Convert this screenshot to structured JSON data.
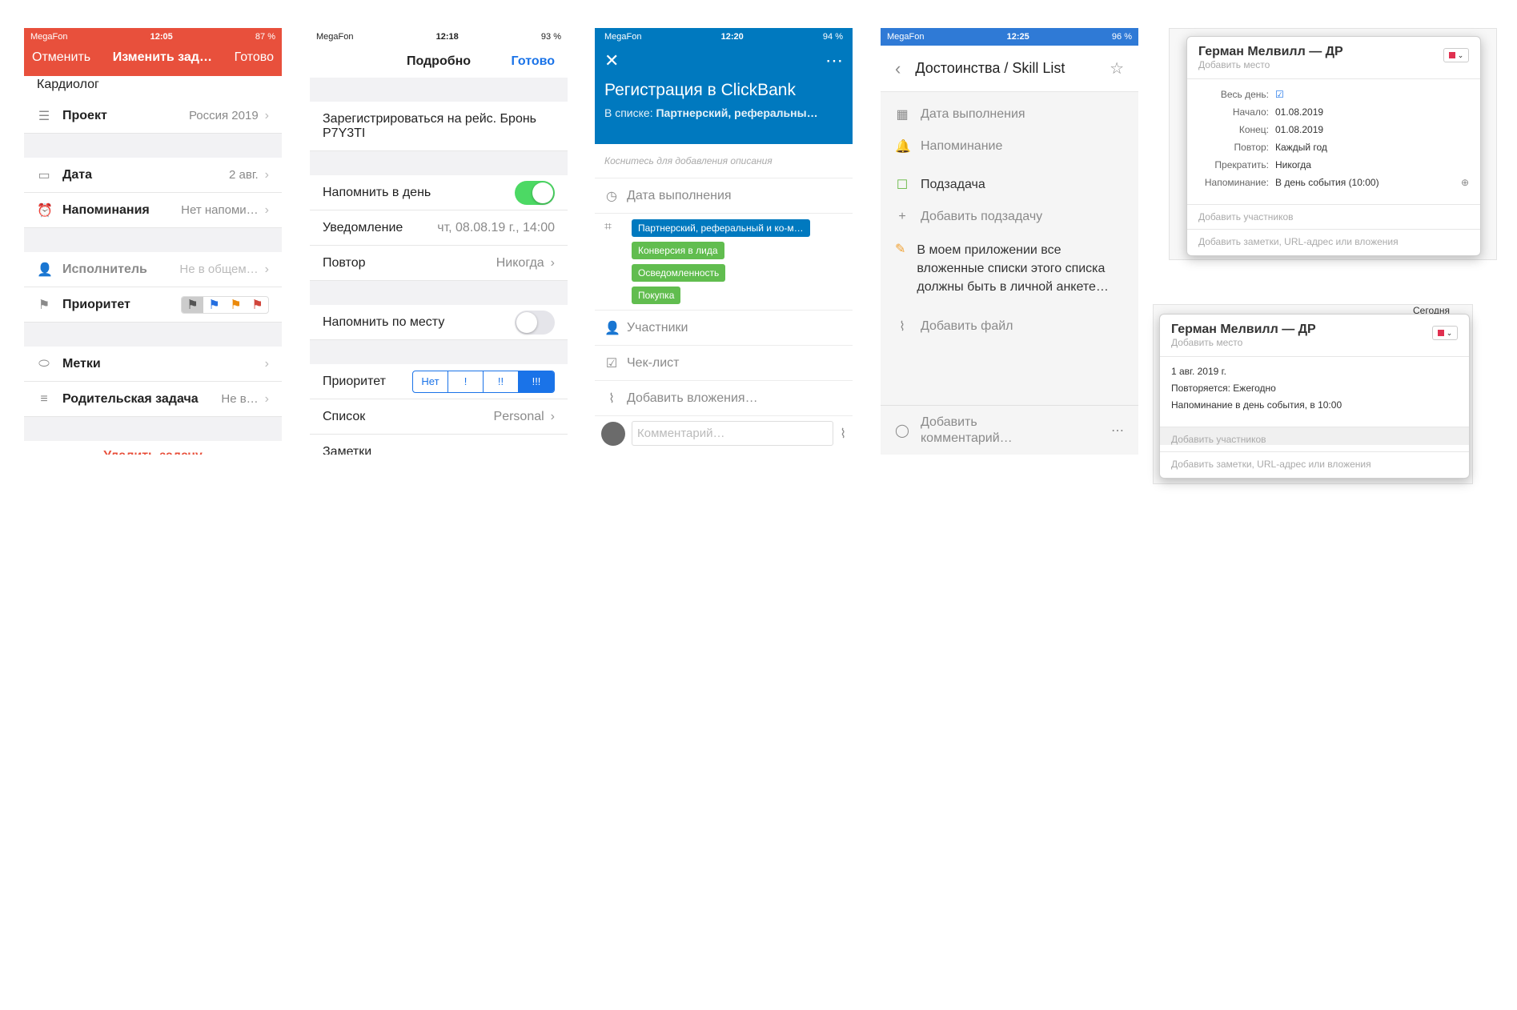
{
  "p1": {
    "status": {
      "carrier": "MegaFon",
      "time": "12:05",
      "battery": "87 %"
    },
    "cancel": "Отменить",
    "title": "Изменить зад…",
    "done": "Готово",
    "top": "Кардиолог",
    "project_label": "Проект",
    "project_value": "Россия 2019",
    "date_label": "Дата",
    "date_value": "2 авг.",
    "rem_label": "Напоминания",
    "rem_value": "Нет напоми…",
    "assignee_label": "Исполнитель",
    "assignee_value": "Не в общем…",
    "priority_label": "Приоритет",
    "tags_label": "Метки",
    "parent_label": "Родительская задача",
    "parent_value": "Не в…",
    "delete": "Удалить задачу",
    "accent": "#e8503c"
  },
  "p2": {
    "status": {
      "carrier": "MegaFon",
      "time": "12:18",
      "battery": "93 %"
    },
    "title": "Подробно",
    "done": "Готово",
    "task": "Зарегистрироваться на рейс. Бронь P7Y3TI",
    "remind_day": "Напомнить в день",
    "alert_label": "Уведомление",
    "alert_value": "чт, 08.08.19 г., 14:00",
    "repeat_label": "Повтор",
    "repeat_value": "Никогда",
    "remind_place": "Напомнить по месту",
    "priority_label": "Приоритет",
    "prio": [
      "Нет",
      "!",
      "!!",
      "!!!"
    ],
    "list_label": "Список",
    "list_value": "Personal",
    "notes_label": "Заметки"
  },
  "p3": {
    "status": {
      "carrier": "MegaFon",
      "time": "12:20",
      "battery": "94 %"
    },
    "title": "Регистрация в ClickBank",
    "list_prefix": "В списке:",
    "list_name": "Партнерский, реферальны…",
    "desc_hint": "Коснитесь для добавления описания",
    "due": "Дата выполнения",
    "labels": [
      "Партнерский, реферальный и ко-м…",
      "Конверсия в лида",
      "Осведомленность",
      "Покупка"
    ],
    "members": "Участники",
    "checklist": "Чек-лист",
    "attach": "Добавить вложения…",
    "comment_ph": "Комментарий…",
    "accent": "#0079bf"
  },
  "p4": {
    "status": {
      "carrier": "MegaFon",
      "time": "12:25",
      "battery": "96 %"
    },
    "title": "Достоинства / Skill List",
    "due": "Дата выполнения",
    "reminder": "Напоминание",
    "subtask": "Подзадача",
    "add_subtask": "Добавить подзадачу",
    "note": "В моем приложении все вложенные списки этого списка должны быть в личной анкете…",
    "add_file": "Добавить файл",
    "add_comment": "Добавить комментарий…"
  },
  "pop1": {
    "title": "Герман Мелвилл — ДР",
    "place": "Добавить место",
    "allday": "Весь день:",
    "start_l": "Начало:",
    "start_v": "01.08.2019",
    "end_l": "Конец:",
    "end_v": "01.08.2019",
    "repeat_l": "Повтор:",
    "repeat_v": "Каждый год",
    "stop_l": "Прекратить:",
    "stop_v": "Никогда",
    "remind_l": "Напоминание:",
    "remind_v": "В день события (10:00)",
    "participants": "Добавить участников",
    "notes": "Добавить заметки, URL-адрес или вложения"
  },
  "pop2": {
    "title": "Герман Мелвилл — ДР",
    "place": "Добавить место",
    "date": "1 авг. 2019 г.",
    "repeat": "Повторяется: Ежегодно",
    "remind": "Напоминание в день события, в 10:00",
    "participants": "Добавить участников",
    "notes": "Добавить заметки, URL-адрес или вложения",
    "today": "Сегодня"
  }
}
